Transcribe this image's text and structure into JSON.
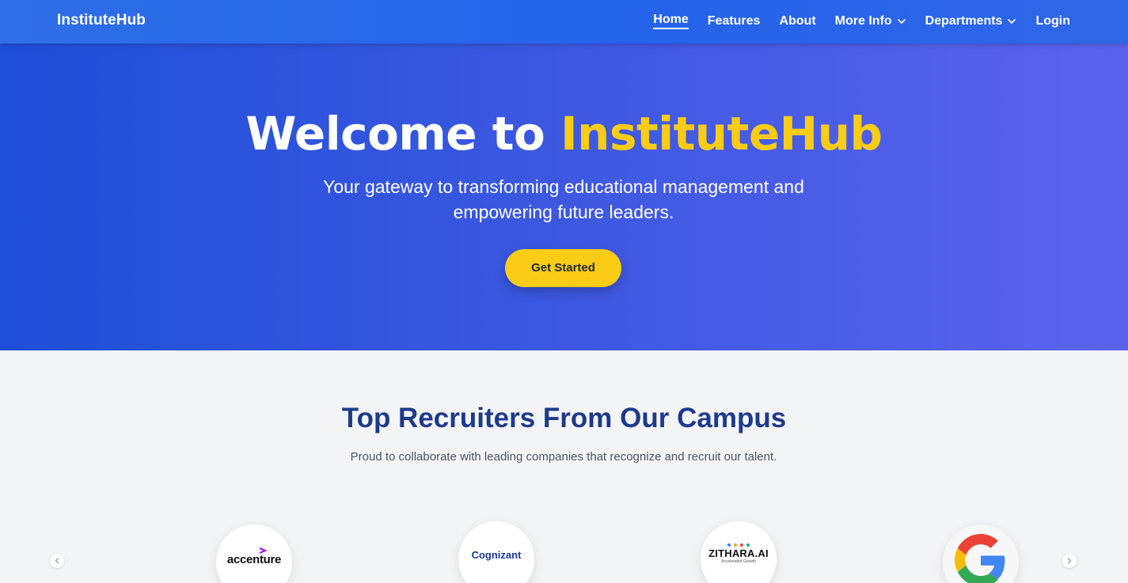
{
  "navbar": {
    "brand": "InstituteHub",
    "links": [
      {
        "label": "Home",
        "active": true,
        "dropdown": false
      },
      {
        "label": "Features",
        "active": false,
        "dropdown": false
      },
      {
        "label": "About",
        "active": false,
        "dropdown": false
      },
      {
        "label": "More Info",
        "active": false,
        "dropdown": true
      },
      {
        "label": "Departments",
        "active": false,
        "dropdown": true
      },
      {
        "label": "Login",
        "active": false,
        "dropdown": false
      }
    ]
  },
  "hero": {
    "title_prefix": "Welcome to ",
    "title_highlight": "InstituteHub",
    "subtitle": "Your gateway to transforming educational management and empowering future leaders.",
    "cta_label": "Get Started"
  },
  "recruiters": {
    "title": "Top Recruiters From Our Campus",
    "subtitle": "Proud to collaborate with leading companies that recognize and recruit our talent.",
    "logos": [
      {
        "name": "accenture",
        "icon": "accenture-logo"
      },
      {
        "name": "Cognizant",
        "icon": "cognizant-logo"
      },
      {
        "name": "ZITHARA.AI",
        "tagline": "Accelerated Growth",
        "icon": "zithara-logo"
      },
      {
        "name": "Google",
        "icon": "google-g-logo"
      }
    ],
    "prev_icon": "chevron-left-icon",
    "next_icon": "chevron-right-icon"
  },
  "colors": {
    "primary": "#2563eb",
    "accent": "#facc15",
    "heading": "#1e3a8a",
    "background": "#f3f4f6"
  }
}
